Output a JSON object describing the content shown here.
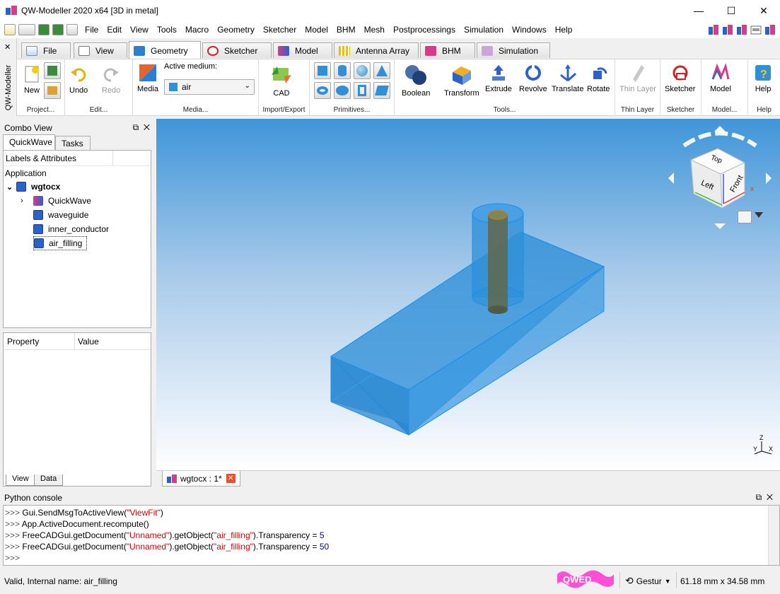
{
  "window": {
    "title": "QW-Modeller 2020 x64 [3D in metal]",
    "minimize_glyph": "—",
    "maximize_glyph": "☐",
    "close_glyph": "✕"
  },
  "menu": [
    "File",
    "Edit",
    "View",
    "Tools",
    "Macro",
    "Geometry",
    "Sketcher",
    "Model",
    "BHM",
    "Mesh",
    "Postprocessings",
    "Simulation",
    "Windows",
    "Help"
  ],
  "side_panel": {
    "label": "QW-Modeller",
    "close_glyph": "✕"
  },
  "workbench_tabs": [
    {
      "label": "File",
      "icon": "file-icon"
    },
    {
      "label": "View",
      "icon": "view-cube-icon"
    },
    {
      "label": "Geometry",
      "icon": "geometry-icon",
      "active": true
    },
    {
      "label": "Sketcher",
      "icon": "sketcher-icon"
    },
    {
      "label": "Model",
      "icon": "model-icon"
    },
    {
      "label": "Antenna Array",
      "icon": "antenna-array-icon"
    },
    {
      "label": "BHM",
      "icon": "bhm-icon"
    },
    {
      "label": "Simulation",
      "icon": "simulation-icon"
    }
  ],
  "toolbar": {
    "new": "New",
    "project_group": "Project...",
    "undo": "Undo",
    "redo": "Redo",
    "edit_group": "Edit...",
    "media": "Media",
    "active_medium_label": "Active medium:",
    "active_medium_value": "air",
    "media_group": "Media...",
    "cad": "CAD",
    "import_export_group": "Import/Export",
    "primitives_group": "Primitives...",
    "boolean": "Boolean",
    "transform": "Transform",
    "extrude": "Extrude",
    "revolve": "Revolve",
    "translate": "Translate",
    "rotate": "Rotate",
    "tools_group": "Tools...",
    "thin_layer": "Thin Layer",
    "thin_layer_group": "Thin Layer",
    "sketcher": "Sketcher",
    "sketcher_group": "Sketcher",
    "model": "Model",
    "model_group": "Model...",
    "help": "Help",
    "help_group": "Help"
  },
  "combo_view": {
    "title": "Combo View",
    "tabs": [
      "QuickWave",
      "Tasks"
    ],
    "tree_header": "Labels & Attributes",
    "tree": {
      "application": "Application",
      "root": "wgtocx",
      "children": [
        "QuickWave",
        "waveguide",
        "inner_conductor",
        "air_filling"
      ]
    },
    "property_header": "Property",
    "value_header": "Value",
    "bottom_tabs": [
      "View",
      "Data"
    ]
  },
  "nav_cube": {
    "top": "Top",
    "left": "Left",
    "front": "Front",
    "axis_x": "x"
  },
  "axis_indicator": {
    "z": "Z",
    "y": "Y",
    "x": "X"
  },
  "document_tab": {
    "label": "wgtocx : 1*",
    "close_glyph": "✕"
  },
  "python_console": {
    "title": "Python console",
    "lines": [
      {
        "prompt": ">>> ",
        "a": "Gui.SendMsgToActiveView(",
        "s1": "\"ViewFit\"",
        "b": ")",
        "s2": "",
        "c": "",
        "n": ""
      },
      {
        "prompt": ">>> ",
        "a": "App.ActiveDocument.recompute()",
        "s1": "",
        "b": "",
        "s2": "",
        "c": "",
        "n": ""
      },
      {
        "prompt": ">>> ",
        "a": "FreeCADGui.getDocument(",
        "s1": "\"Unnamed\"",
        "b": ").getObject(",
        "s2": "\"air_filling\"",
        "c": ").Transparency = ",
        "n": "5"
      },
      {
        "prompt": ">>> ",
        "a": "FreeCADGui.getDocument(",
        "s1": "\"Unnamed\"",
        "b": ").getObject(",
        "s2": "\"air_filling\"",
        "c": ").Transparency = ",
        "n": "50"
      },
      {
        "prompt": ">>> ",
        "a": "",
        "s1": "",
        "b": "",
        "s2": "",
        "c": "",
        "n": ""
      }
    ]
  },
  "status": {
    "message": "Valid, Internal name: air_filling",
    "logo_text": "QWED",
    "navigation": "Gestur",
    "dimensions": "61.18 mm x 34.58 mm"
  },
  "colors": {
    "accent": "#0078d7",
    "viewport_top": "#3f95d9",
    "object_fill": "#2f8fd8",
    "conductor": "#6b6b4a",
    "logo": "#ff4fd8"
  }
}
